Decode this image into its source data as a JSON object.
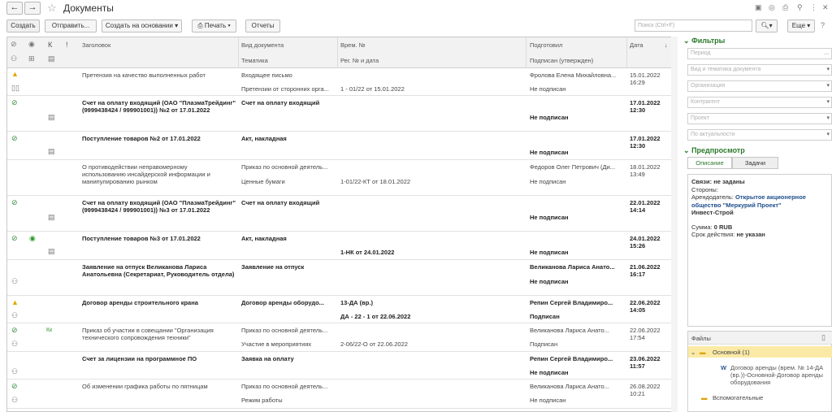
{
  "window": {
    "title": "Документы",
    "back": "←",
    "forward": "→"
  },
  "toolbar": {
    "create": "Создать",
    "send": "Отправить...",
    "create_based": "Создать на основании",
    "print": "Печать",
    "reports": "Отчеты",
    "search_placeholder": "Поиск (Ctrl+F)",
    "more": "Еще"
  },
  "columns": {
    "k": "К",
    "excl": "!",
    "title": "Заголовок",
    "doc_type": "Вид документа",
    "topic": "Тематика",
    "temp_no": "Врем. №",
    "reg_no": "Рег. № и дата",
    "prepared": "Подготовил",
    "signed": "Подписан (утвержден)",
    "date": "Дата"
  },
  "rows": [
    {
      "title": "Претензия на качество выполненных работ",
      "type": "Входящее письмо",
      "topic": "Претензии от сторонних орга...",
      "temp": "",
      "reg": "1 - 01/22 от 15.01.2022",
      "prep": "Фролова Елена Михайловна...",
      "signed": "Не подписан",
      "date": "15.01.2022",
      "time": "16:29"
    },
    {
      "title": "Счет на оплату входящий (ОАО \"ПлазмаТрейдинг\" (9999438424 / 999901001)) №2 от 17.01.2022",
      "type": "Счет на оплату входящий",
      "topic": "",
      "temp": "",
      "reg": "",
      "prep": "",
      "signed": "Не подписан",
      "date": "17.01.2022",
      "time": "12:30"
    },
    {
      "title": "Поступление товаров №2 от 17.01.2022",
      "type": "Акт, накладная",
      "topic": "",
      "temp": "",
      "reg": "",
      "prep": "",
      "signed": "Не подписан",
      "date": "17.01.2022",
      "time": "12:30"
    },
    {
      "title": "О противодействии неправомерному использованию инсайдерской информации и манипулированию рынком",
      "type": "Приказ по основной деятель...",
      "topic": "Ценные бумаги",
      "temp": "",
      "reg": "1-01/22-КТ от 18.01.2022",
      "prep": "Федоров Олег Петрович (Ди...",
      "signed": "Не подписан",
      "date": "18.01.2022",
      "time": "13:49"
    },
    {
      "title": "Счет на оплату входящий (ОАО \"ПлазмаТрейдинг\" (9999438424 / 999901001)) №3 от 17.01.2022",
      "type": "Счет на оплату входящий",
      "topic": "",
      "temp": "",
      "reg": "",
      "prep": "",
      "signed": "Не подписан",
      "date": "22.01.2022",
      "time": "14:14"
    },
    {
      "title": "Поступление товаров №3 от 17.01.2022",
      "type": "Акт, накладная",
      "topic": "",
      "temp": "",
      "reg": "1-НК от 24.01.2022",
      "prep": "",
      "signed": "Не подписан",
      "date": "24.01.2022",
      "time": "15:26"
    },
    {
      "title": "Заявление на отпуск Великанова Лариса Анатольевна (Секретариат, Руководитель отдела)",
      "type": "Заявление на отпуск",
      "topic": "",
      "temp": "",
      "reg": "",
      "prep": "Великанова Лариса Анато...",
      "signed": "Не подписан",
      "date": "21.06.2022",
      "time": "16:17"
    },
    {
      "title": "Договор аренды строительного крана",
      "type": "Договор аренды оборудо...",
      "topic": "",
      "temp": "13-ДА (вр.)",
      "reg": "ДА - 22 - 1 от 22.06.2022",
      "prep": "Репин Сергей Владимиро...",
      "signed": "Подписан",
      "date": "22.06.2022",
      "time": "14:05"
    },
    {
      "title": "Приказ об участии в совещании \"Организация технического сопровождения техники\"",
      "type": "Приказ по основной деятель...",
      "topic": "Участие в мероприятиях",
      "temp": "",
      "reg": "2-06/22-О от 22.06.2022",
      "prep": "Великанова Лариса Анато...",
      "signed": "Подписан",
      "date": "22.06.2022",
      "time": "17:54"
    },
    {
      "title": "Счет за лицензии на программное ПО",
      "type": "Заявка на оплату",
      "topic": "",
      "temp": "",
      "reg": "",
      "prep": "Репин Сергей Владимиро...",
      "signed": "Не подписан",
      "date": "23.06.2022",
      "time": "11:57"
    },
    {
      "title": "Об изменении графика работы по пятницам",
      "type": "Приказ по основной деятель...",
      "topic": "Режим работы",
      "temp": "",
      "reg": "",
      "prep": "Великанова Лариса Анато...",
      "signed": "Не подписан",
      "date": "26.08.2022",
      "time": "10:21"
    }
  ],
  "panel": {
    "filters_title": "Фильтры",
    "f_period": "Период",
    "f_type": "Вид и тематика документа",
    "f_org": "Организация",
    "f_contractor": "Контрагент",
    "f_project": "Проект",
    "f_relevance": "По актуальности",
    "preview_title": "Предпросмотр",
    "tab_desc": "Описание",
    "tab_tasks": "Задачи",
    "links": "Связи: не заданы",
    "parties": "Стороны:",
    "lessor_label": "Арендодатель:",
    "lessor": "Открытое акционерное общество \"Меркурий Проект\"",
    "lessee": "Инвест-Строй",
    "sum_label": "Сумма:",
    "sum": "0 RUB",
    "term_label": "Срок действия:",
    "term": "не указан",
    "files_title": "Файлы",
    "folder_main": "Основной (1)",
    "file_name": "Договор аренды (врем. № 14-ДА (вр.))-Основной-Договор аренды оборудования",
    "folder_aux": "Вспомогательные"
  }
}
